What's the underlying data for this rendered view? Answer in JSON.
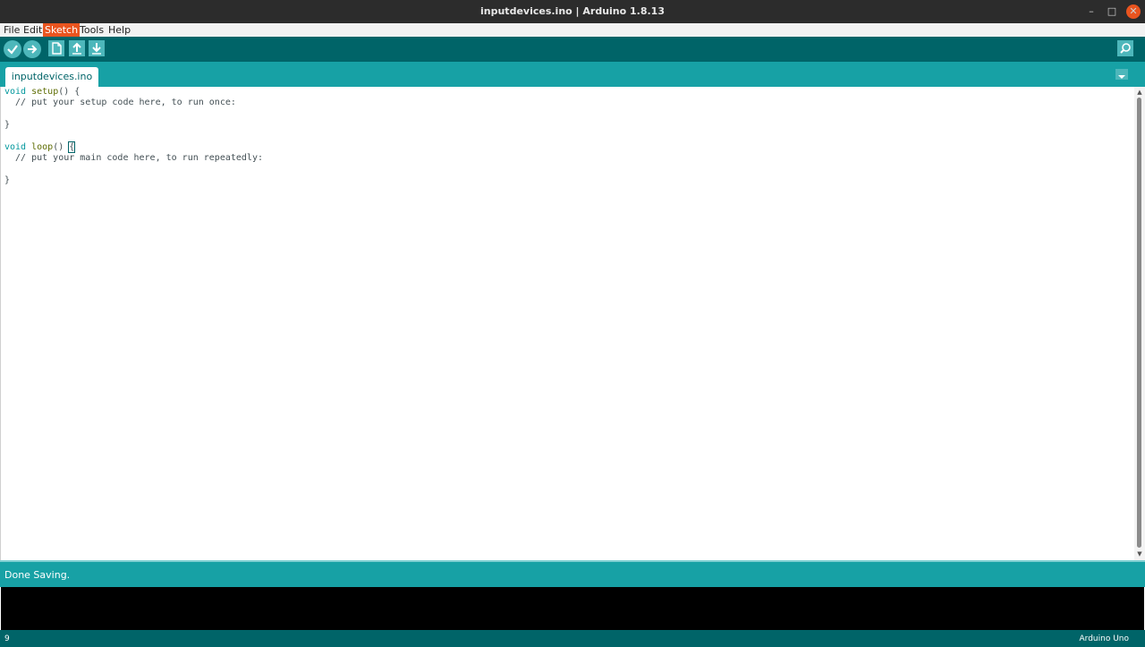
{
  "window": {
    "title": "inputdevices.ino | Arduino 1.8.13",
    "minimize_glyph": "–",
    "maximize_glyph": "□",
    "close_glyph": "✕"
  },
  "menubar": {
    "items": [
      "File",
      "Edit",
      "Sketch",
      "Tools",
      "Help"
    ],
    "active": "Sketch"
  },
  "toolbar": {
    "buttons": [
      {
        "name": "verify-button",
        "icon": "checkmark-icon"
      },
      {
        "name": "upload-button",
        "icon": "arrow-right-icon"
      },
      {
        "name": "new-button",
        "icon": "document-icon"
      },
      {
        "name": "open-button",
        "icon": "arrow-up-icon"
      },
      {
        "name": "save-button",
        "icon": "arrow-down-icon"
      }
    ],
    "serial_monitor_icon": "magnifier-icon"
  },
  "tabs": {
    "active_label": "inputdevices.ino",
    "menu_icon": "chevron-down-icon"
  },
  "editor": {
    "lines": [
      "void setup() {",
      "  // put your setup code here, to run once:",
      "",
      "}",
      "",
      "void loop() {",
      "  // put your main code here, to run repeatedly:",
      "",
      "}"
    ]
  },
  "status": {
    "message": "Done Saving."
  },
  "footer": {
    "line_number": "9",
    "board": "Arduino Uno"
  },
  "colors": {
    "accent_dark": "#006468",
    "accent": "#17a1a5",
    "button": "#4db7bb",
    "menu_highlight": "#e9541f"
  }
}
